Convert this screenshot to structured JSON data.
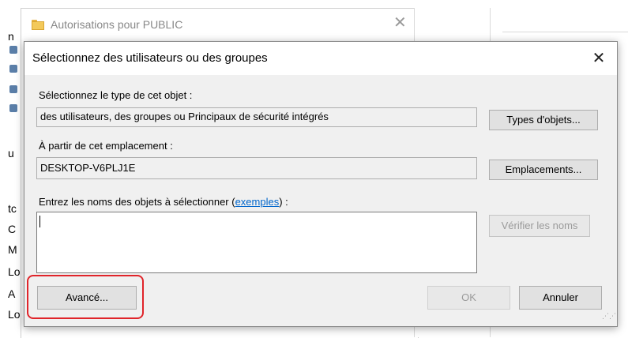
{
  "background": {
    "parent_window_title": "Autorisations pour PUBLIC",
    "left_letters": [
      "n",
      "u",
      "tc",
      "C",
      "M",
      "Lo",
      "A",
      "Lo"
    ]
  },
  "dialog": {
    "title": "Sélectionnez des utilisateurs ou des groupes",
    "object_type_label": "Sélectionnez le type de cet objet :",
    "object_type_value": "des utilisateurs, des groupes ou Principaux de sécurité intégrés",
    "object_types_button": "Types d'objets...",
    "location_label": "À partir de cet emplacement :",
    "location_value": "DESKTOP-V6PLJ1E",
    "locations_button": "Emplacements...",
    "names_label_prefix": "Entrez les noms des objets à sélectionner (",
    "names_label_link": "exemples",
    "names_label_suffix": ") :",
    "names_value": "",
    "check_names_button": "Vérifier les noms",
    "advanced_button": "Avancé...",
    "ok_button": "OK",
    "cancel_button": "Annuler"
  },
  "colors": {
    "highlight": "#e0242a",
    "link": "#0066cc"
  }
}
